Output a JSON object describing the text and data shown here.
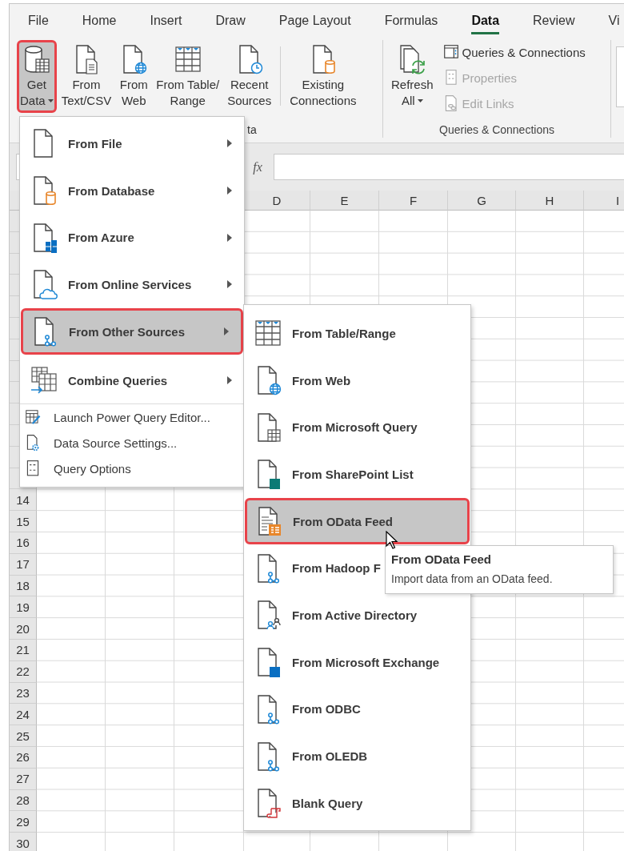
{
  "ribbon": {
    "tabs": [
      {
        "label": "File",
        "selected": false
      },
      {
        "label": "Home",
        "selected": false
      },
      {
        "label": "Insert",
        "selected": false
      },
      {
        "label": "Draw",
        "selected": false
      },
      {
        "label": "Page Layout",
        "selected": false
      },
      {
        "label": "Formulas",
        "selected": false
      },
      {
        "label": "Data",
        "selected": true
      },
      {
        "label": "Review",
        "selected": false
      },
      {
        "label": "Vi",
        "selected": false
      }
    ],
    "buttons": [
      {
        "lines": [
          "Get",
          "Data"
        ],
        "selected": true,
        "dropdown": true
      },
      {
        "lines": [
          "From",
          "Text/CSV"
        ],
        "selected": false,
        "dropdown": false
      },
      {
        "lines": [
          "From",
          "Web"
        ],
        "selected": false,
        "dropdown": false
      },
      {
        "lines": [
          "From Table/",
          "Range"
        ],
        "selected": false,
        "dropdown": false
      },
      {
        "lines": [
          "Recent",
          "Sources"
        ],
        "selected": false,
        "dropdown": false
      },
      {
        "lines": [
          "Existing",
          "Connections"
        ],
        "selected": false,
        "dropdown": false
      },
      {
        "lines": [
          "Refresh",
          "All"
        ],
        "selected": false,
        "dropdown": true
      }
    ],
    "small_buttons": [
      {
        "label": "Queries & Connections",
        "disabled": false
      },
      {
        "label": "Properties",
        "disabled": true
      },
      {
        "label": "Edit Links",
        "disabled": true
      }
    ],
    "group_labels": [
      "ta",
      "Queries & Connections"
    ]
  },
  "formula_bar": {
    "function_label": "fx"
  },
  "sheet": {
    "columns": [
      "D",
      "E",
      "F",
      "G",
      "H",
      "I"
    ],
    "rows": [
      "14",
      "15",
      "16",
      "17",
      "18",
      "19",
      "20",
      "21",
      "22",
      "23",
      "24",
      "25",
      "26",
      "27",
      "28",
      "29",
      "30"
    ]
  },
  "get_data_menu": {
    "items": [
      {
        "kind": "large",
        "label": "From File",
        "has_submenu": true,
        "selected": false
      },
      {
        "kind": "large",
        "label": "From Database",
        "has_submenu": true,
        "selected": false
      },
      {
        "kind": "large",
        "label": "From Azure",
        "has_submenu": true,
        "selected": false
      },
      {
        "kind": "large",
        "label": "From Online Services",
        "has_submenu": true,
        "selected": false
      },
      {
        "kind": "large",
        "label": "From Other Sources",
        "has_submenu": true,
        "selected": true
      },
      {
        "kind": "large",
        "label": "Combine Queries",
        "has_submenu": true,
        "selected": false
      },
      {
        "kind": "small",
        "label": "Launch Power Query Editor...",
        "has_submenu": false,
        "selected": false
      },
      {
        "kind": "small",
        "label": "Data Source Settings...",
        "has_submenu": false,
        "selected": false
      },
      {
        "kind": "small",
        "label": "Query Options",
        "has_submenu": false,
        "selected": false
      }
    ]
  },
  "other_sources_menu": {
    "items": [
      {
        "label": "From Table/Range",
        "selected": false
      },
      {
        "label": "From Web",
        "selected": false
      },
      {
        "label": "From Microsoft Query",
        "selected": false
      },
      {
        "label": "From SharePoint List",
        "selected": false
      },
      {
        "label": "From OData Feed",
        "selected": true
      },
      {
        "label": "From Hadoop F",
        "selected": false
      },
      {
        "label": "From Active Directory",
        "selected": false
      },
      {
        "label": "From Microsoft Exchange",
        "selected": false
      },
      {
        "label": "From ODBC",
        "selected": false
      },
      {
        "label": "From OLEDB",
        "selected": false
      },
      {
        "label": "Blank Query",
        "selected": false
      }
    ]
  },
  "tooltip": {
    "title": "From OData Feed",
    "description": "Import data from an OData feed."
  }
}
